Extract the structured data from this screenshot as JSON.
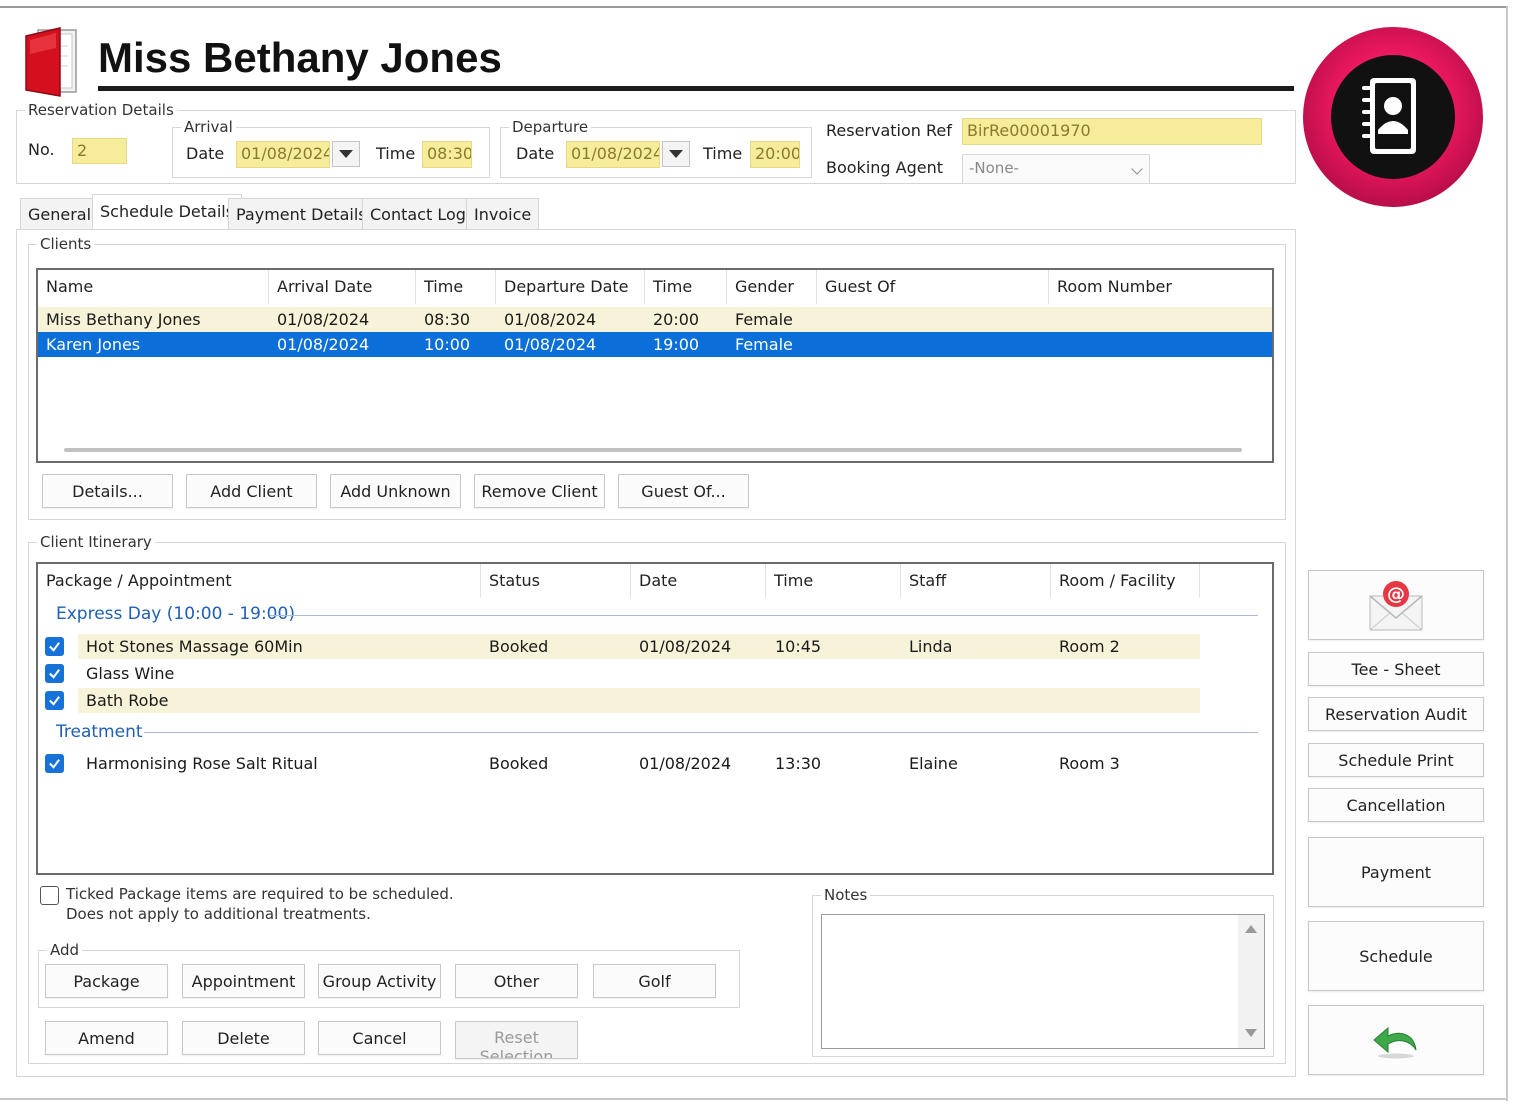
{
  "title": "Miss Bethany Jones",
  "reservation": {
    "legend": "Reservation Details",
    "no_label": "No.",
    "no_value": "2",
    "arrival": {
      "legend": "Arrival",
      "date_label": "Date",
      "date_value": "01/08/2024",
      "time_label": "Time",
      "time_value": "08:30"
    },
    "departure": {
      "legend": "Departure",
      "date_label": "Date",
      "date_value": "01/08/2024",
      "time_label": "Time",
      "time_value": "20:00"
    },
    "ref_label": "Reservation Ref",
    "ref_value": "BirRe00001970",
    "agent_label": "Booking Agent",
    "agent_value": "-None-"
  },
  "tabs": [
    "General",
    "Schedule Details",
    "Payment Details",
    "Contact Log",
    "Invoice"
  ],
  "active_tab": "Schedule Details",
  "clients": {
    "legend": "Clients",
    "columns": [
      "Name",
      "Arrival Date",
      "Time",
      "Departure Date",
      "Time",
      "Gender",
      "Guest Of",
      "Room Number"
    ],
    "rows": [
      {
        "name": "Miss Bethany Jones",
        "arrival_date": "01/08/2024",
        "arrival_time": "08:30",
        "departure_date": "01/08/2024",
        "departure_time": "20:00",
        "gender": "Female",
        "guest_of": "",
        "room_number": ""
      },
      {
        "name": "Karen Jones",
        "arrival_date": "01/08/2024",
        "arrival_time": "10:00",
        "departure_date": "01/08/2024",
        "departure_time": "19:00",
        "gender": "Female",
        "guest_of": "",
        "room_number": ""
      }
    ],
    "buttons": {
      "details": "Details...",
      "add_client": "Add Client",
      "add_unknown": "Add Unknown",
      "remove_client": "Remove Client",
      "guest_of": "Guest Of..."
    }
  },
  "itinerary": {
    "legend": "Client Itinerary",
    "columns": [
      "Package / Appointment",
      "Status",
      "Date",
      "Time",
      "Staff",
      "Room / Facility"
    ],
    "groups": [
      {
        "header": "Express Day (10:00 - 19:00)",
        "items": [
          {
            "name": "Hot Stones Massage 60Min",
            "status": "Booked",
            "date": "01/08/2024",
            "time": "10:45",
            "staff": "Linda",
            "room": "Room 2"
          },
          {
            "name": "Glass Wine",
            "status": "",
            "date": "",
            "time": "",
            "staff": "",
            "room": ""
          },
          {
            "name": "Bath Robe",
            "status": "",
            "date": "",
            "time": "",
            "staff": "",
            "room": ""
          }
        ]
      },
      {
        "header": "Treatment",
        "items": [
          {
            "name": "Harmonising Rose Salt Ritual",
            "status": "Booked",
            "date": "01/08/2024",
            "time": "13:30",
            "staff": "Elaine",
            "room": "Room 3"
          }
        ]
      }
    ]
  },
  "ticked_note_line1": "Ticked Package items are required to be scheduled.",
  "ticked_note_line2": "Does not apply to additional treatments.",
  "add": {
    "legend": "Add",
    "buttons": {
      "package": "Package",
      "appointment": "Appointment",
      "group_activity": "Group Activity",
      "other": "Other",
      "golf": "Golf"
    }
  },
  "actions": {
    "amend": "Amend",
    "delete": "Delete",
    "cancel": "Cancel",
    "reset_selection": "Reset Selection"
  },
  "notes": {
    "legend": "Notes",
    "value": ""
  },
  "side": {
    "tee_sheet": "Tee - Sheet",
    "reservation_audit": "Reservation Audit",
    "schedule_print": "Schedule Print",
    "cancellation": "Cancellation",
    "payment": "Payment",
    "schedule": "Schedule"
  },
  "colors": {
    "selection": "#0a6fd8",
    "highlight_field": "#f7ec9a",
    "row_cream": "#f7f3d8",
    "group_header": "#1f5fb5",
    "badge_pink": "#e8175d"
  }
}
